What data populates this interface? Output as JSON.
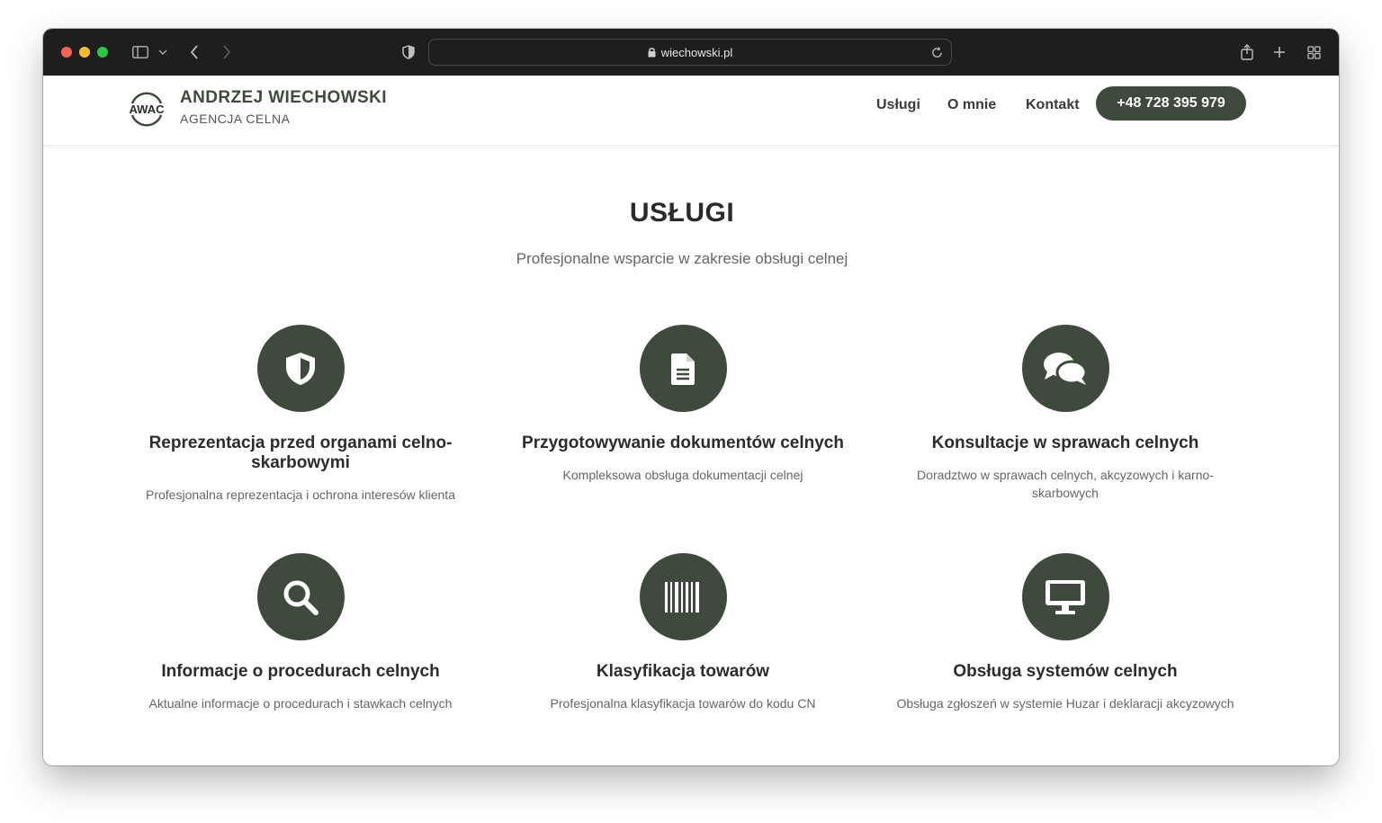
{
  "browser": {
    "url": "wiechowski.pl",
    "icons": [
      "sidebar-icon",
      "chevron-down-icon",
      "back-arrow-icon",
      "forward-arrow-icon",
      "privacy-shield-icon",
      "lock-icon",
      "reload-icon",
      "share-icon",
      "plus-icon",
      "tab-overview-icon"
    ]
  },
  "header": {
    "logo_text": "AWAC",
    "brand_name": "ANDRZEJ WIECHOWSKI",
    "brand_sub": "AGENCJA CELNA",
    "nav": {
      "uslugi": "Usługi",
      "omnie": "O mnie",
      "kontakt": "Kontakt"
    },
    "phone": "+48 728 395 979"
  },
  "main": {
    "title": "USŁUGI",
    "subtitle": "Profesjonalne wsparcie w zakresie obsługi celnej",
    "services": [
      {
        "icon": "shield-icon",
        "title": "Reprezentacja przed organami celno-skarbowymi",
        "desc": "Profesjonalna reprezentacja i ochrona interesów klienta"
      },
      {
        "icon": "document-icon",
        "title": "Przygotowywanie dokumentów celnych",
        "desc": "Kompleksowa obsługa dokumentacji celnej"
      },
      {
        "icon": "chat-icon",
        "title": "Konsultacje w sprawach celnych",
        "desc": "Doradztwo w sprawach celnych, akcyzowych i karno-skarbowych"
      },
      {
        "icon": "search-icon",
        "title": "Informacje o procedurach celnych",
        "desc": "Aktualne informacje o procedurach i stawkach celnych"
      },
      {
        "icon": "barcode-icon",
        "title": "Klasyfikacja towarów",
        "desc": "Profesjonalna klasyfikacja towarów do kodu CN"
      },
      {
        "icon": "monitor-icon",
        "title": "Obsługa systemów celnych",
        "desc": "Obsługa zgłoszeń w systemie Huzar i deklaracji akcyzowych"
      }
    ]
  },
  "colors": {
    "accent": "#3e4a3b",
    "chrome": "#1e1e1e",
    "heading": "#2a2a2a",
    "muted": "#666666"
  }
}
